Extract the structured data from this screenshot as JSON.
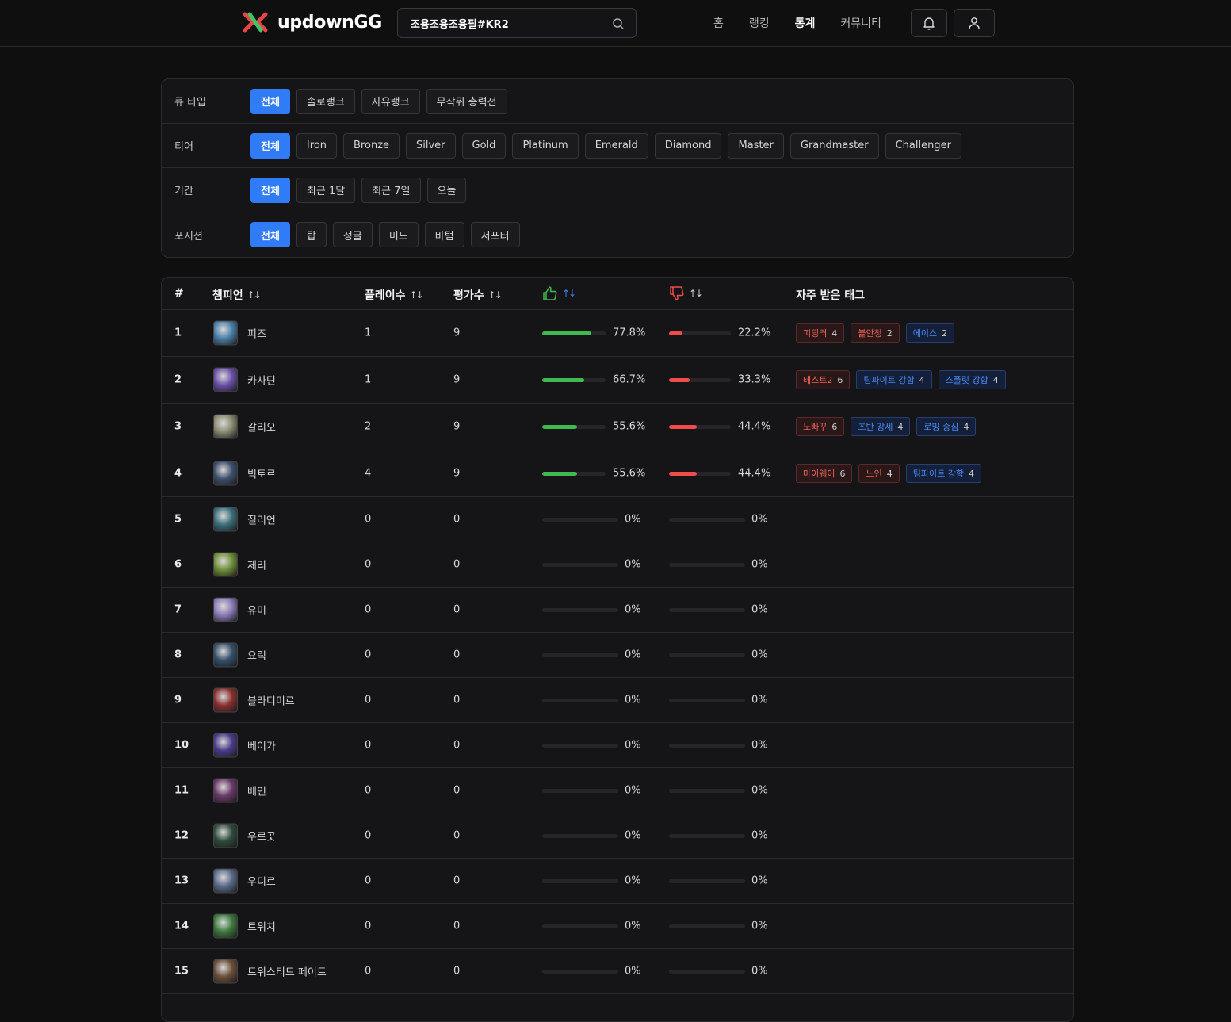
{
  "header": {
    "logo_text": "updownGG",
    "search_value": "조용조용조용필#KR2",
    "nav": [
      "홈",
      "랭킹",
      "통계",
      "커뮤니티"
    ],
    "nav_active": "통계"
  },
  "filters": {
    "queue": {
      "label": "큐 타입",
      "options": [
        "전체",
        "솔로랭크",
        "자유랭크",
        "무작위 총력전"
      ]
    },
    "tier": {
      "label": "티어",
      "options": [
        "전체",
        "Iron",
        "Bronze",
        "Silver",
        "Gold",
        "Platinum",
        "Emerald",
        "Diamond",
        "Master",
        "Grandmaster",
        "Challenger"
      ]
    },
    "period": {
      "label": "기간",
      "options": [
        "전체",
        "최근 1달",
        "최근 7일",
        "오늘"
      ]
    },
    "position": {
      "label": "포지션",
      "options": [
        "전체",
        "탑",
        "정글",
        "미드",
        "바텀",
        "서포터"
      ]
    }
  },
  "table": {
    "headers": {
      "rank": "#",
      "champion": "챔피언",
      "plays": "플레이수",
      "ratings": "평가수",
      "tags": "자주 받은 태그"
    },
    "rows": [
      {
        "rank": "1",
        "name": "피즈",
        "plays": "1",
        "ratings": "9",
        "up": 77.8,
        "up_label": "77.8%",
        "down": 22.2,
        "down_label": "22.2%",
        "tags": [
          {
            "text": "피딩러",
            "count": "4",
            "kind": "neg"
          },
          {
            "text": "불안정",
            "count": "2",
            "kind": "neg"
          },
          {
            "text": "에이스",
            "count": "2",
            "kind": "pos"
          }
        ]
      },
      {
        "rank": "2",
        "name": "카사딘",
        "plays": "1",
        "ratings": "9",
        "up": 66.7,
        "up_label": "66.7%",
        "down": 33.3,
        "down_label": "33.3%",
        "tags": [
          {
            "text": "테스트2",
            "count": "6",
            "kind": "neg"
          },
          {
            "text": "팀파이트 강함",
            "count": "4",
            "kind": "pos"
          },
          {
            "text": "스플릿 강함",
            "count": "4",
            "kind": "pos"
          }
        ]
      },
      {
        "rank": "3",
        "name": "갈리오",
        "plays": "2",
        "ratings": "9",
        "up": 55.6,
        "up_label": "55.6%",
        "down": 44.4,
        "down_label": "44.4%",
        "tags": [
          {
            "text": "노빠꾸",
            "count": "6",
            "kind": "neg"
          },
          {
            "text": "초반 강세",
            "count": "4",
            "kind": "pos"
          },
          {
            "text": "로밍 중심",
            "count": "4",
            "kind": "pos"
          }
        ]
      },
      {
        "rank": "4",
        "name": "빅토르",
        "plays": "4",
        "ratings": "9",
        "up": 55.6,
        "up_label": "55.6%",
        "down": 44.4,
        "down_label": "44.4%",
        "tags": [
          {
            "text": "마이웨이",
            "count": "6",
            "kind": "neg"
          },
          {
            "text": "노인",
            "count": "4",
            "kind": "neg"
          },
          {
            "text": "팀파이트 강함",
            "count": "4",
            "kind": "pos"
          }
        ]
      },
      {
        "rank": "5",
        "name": "질리언",
        "plays": "0",
        "ratings": "0",
        "up": 0,
        "up_label": "0%",
        "down": 0,
        "down_label": "0%",
        "tags": []
      },
      {
        "rank": "6",
        "name": "제리",
        "plays": "0",
        "ratings": "0",
        "up": 0,
        "up_label": "0%",
        "down": 0,
        "down_label": "0%",
        "tags": []
      },
      {
        "rank": "7",
        "name": "유미",
        "plays": "0",
        "ratings": "0",
        "up": 0,
        "up_label": "0%",
        "down": 0,
        "down_label": "0%",
        "tags": []
      },
      {
        "rank": "8",
        "name": "요릭",
        "plays": "0",
        "ratings": "0",
        "up": 0,
        "up_label": "0%",
        "down": 0,
        "down_label": "0%",
        "tags": []
      },
      {
        "rank": "9",
        "name": "블라디미르",
        "plays": "0",
        "ratings": "0",
        "up": 0,
        "up_label": "0%",
        "down": 0,
        "down_label": "0%",
        "tags": []
      },
      {
        "rank": "10",
        "name": "베이가",
        "plays": "0",
        "ratings": "0",
        "up": 0,
        "up_label": "0%",
        "down": 0,
        "down_label": "0%",
        "tags": []
      },
      {
        "rank": "11",
        "name": "베인",
        "plays": "0",
        "ratings": "0",
        "up": 0,
        "up_label": "0%",
        "down": 0,
        "down_label": "0%",
        "tags": []
      },
      {
        "rank": "12",
        "name": "우르곳",
        "plays": "0",
        "ratings": "0",
        "up": 0,
        "up_label": "0%",
        "down": 0,
        "down_label": "0%",
        "tags": []
      },
      {
        "rank": "13",
        "name": "우디르",
        "plays": "0",
        "ratings": "0",
        "up": 0,
        "up_label": "0%",
        "down": 0,
        "down_label": "0%",
        "tags": []
      },
      {
        "rank": "14",
        "name": "트위치",
        "plays": "0",
        "ratings": "0",
        "up": 0,
        "up_label": "0%",
        "down": 0,
        "down_label": "0%",
        "tags": []
      },
      {
        "rank": "15",
        "name": "트위스티드 페이트",
        "plays": "0",
        "ratings": "0",
        "up": 0,
        "up_label": "0%",
        "down": 0,
        "down_label": "0%",
        "tags": []
      }
    ]
  },
  "colors": {
    "accent": "#2f7cf6",
    "up_bar": "#3fb950",
    "down_bar": "#f24b4b",
    "neg_tag": "#f0625b",
    "pos_tag": "#4c8bf5"
  }
}
